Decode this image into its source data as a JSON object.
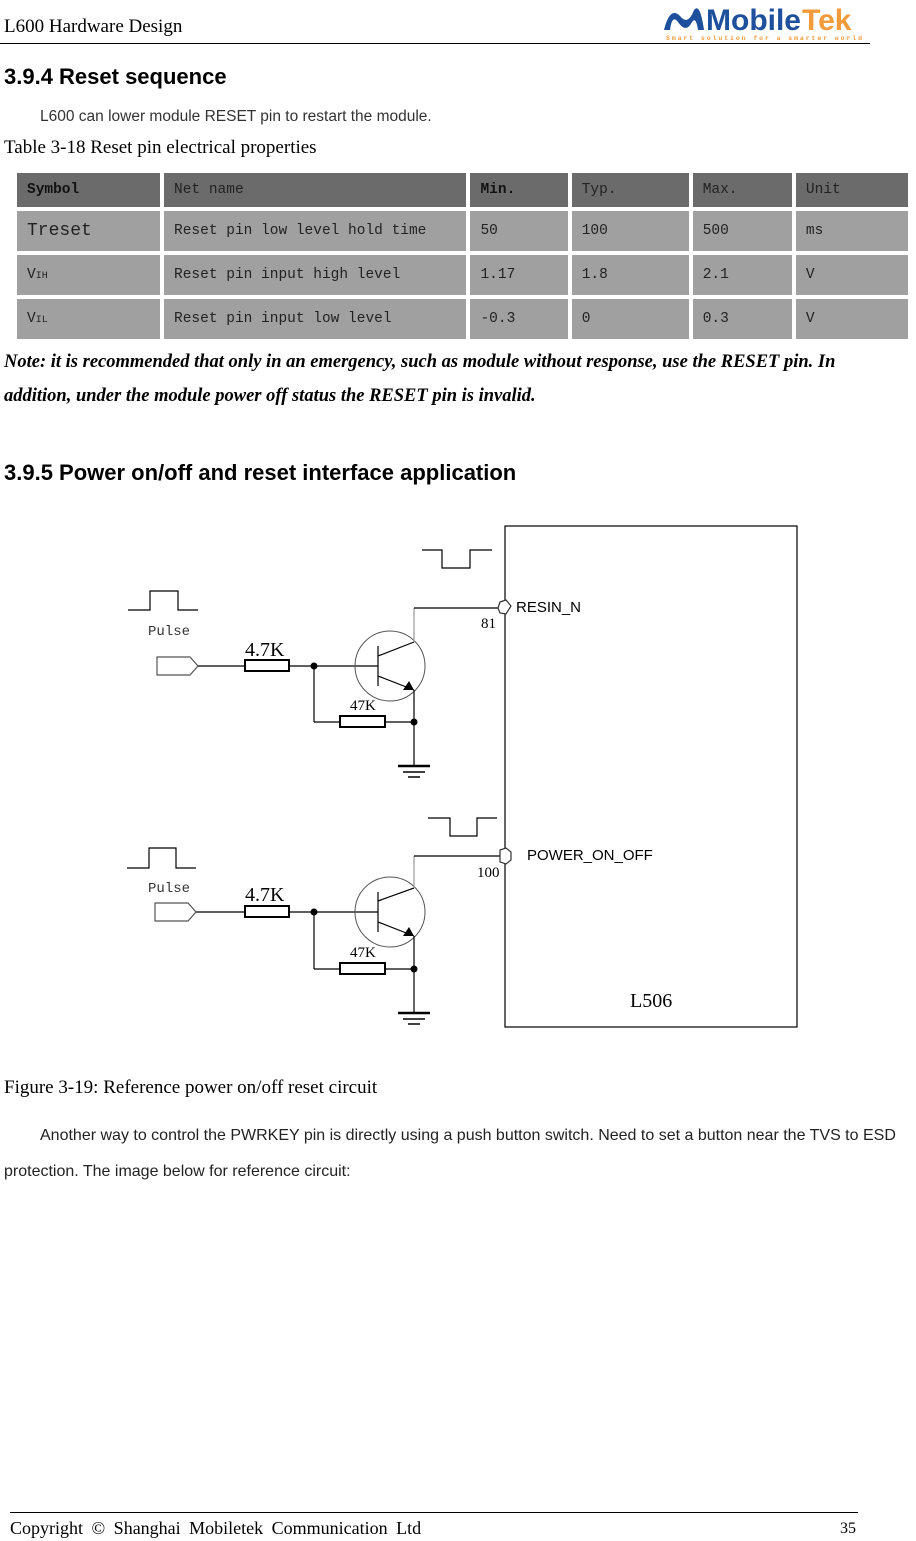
{
  "header": {
    "title": "L600 Hardware Design",
    "logo_text_dark": "Mobile",
    "logo_text_accent": "Tek",
    "logo_tagline": "Smart solution for a smarter world",
    "logo_colors": {
      "primary": "#1d4f9c",
      "accent": "#f39a3a"
    }
  },
  "section_394": {
    "heading": "3.9.4 Reset sequence",
    "intro": "L600 can lower module RESET pin to restart the module.",
    "table_caption": "Table 3-18 Reset pin electrical properties",
    "table": {
      "headers": [
        "Symbol",
        "Net name",
        "Min.",
        "Typ.",
        "Max.",
        "Unit"
      ],
      "rows": [
        {
          "symbol": "Treset",
          "symbol_sub": "",
          "net_name": "Reset pin low level hold time",
          "min": "50",
          "typ": "100",
          "max": "500",
          "unit": "ms"
        },
        {
          "symbol": "V",
          "symbol_sub": "IH",
          "net_name": "Reset pin input high level",
          "min": "1.17",
          "typ": "1.8",
          "max": "2.1",
          "unit": "V"
        },
        {
          "symbol": "V",
          "symbol_sub": "IL",
          "net_name": "Reset pin input low level",
          "min": "-0.3",
          "typ": "0",
          "max": "0.3",
          "unit": "V"
        }
      ],
      "colors": {
        "header_bg": "#6b6b6b",
        "body_bg": "#a0a0a0"
      }
    },
    "note": "Note: it is recommended that only in an emergency, such as module without response, use the RESET pin. In addition, under the module power off status the RESET pin is invalid."
  },
  "section_395": {
    "heading": "3.9.5 Power on/off and reset interface application",
    "schematic": {
      "module_label": "L506",
      "circuits": [
        {
          "input_label": "Pulse",
          "series_resistor": "4.7K",
          "pulldown_resistor": "47K",
          "pin_number": "81",
          "pin_name": "RESIN_N"
        },
        {
          "input_label": "Pulse",
          "series_resistor": "4.7K",
          "pulldown_resistor": "47K",
          "pin_number": "100",
          "pin_name": "POWER_ON_OFF"
        }
      ]
    },
    "figure_caption": "Figure 3-19: Reference power on/off reset circuit",
    "paragraph": "Another way to control the PWRKEY pin is directly using a push button switch. Need to set a button near the TVS to ESD protection. The image below for reference circuit:"
  },
  "footer": {
    "copyright": "Copyright © Shanghai Mobiletek Communication Ltd",
    "page_number": "35"
  }
}
